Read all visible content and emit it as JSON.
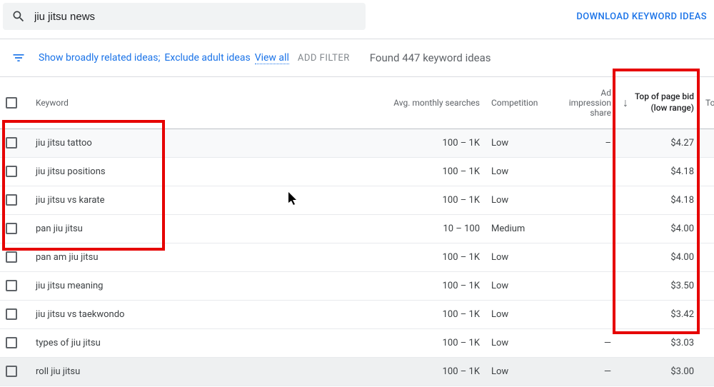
{
  "search": {
    "query": "jiu jitsu news"
  },
  "header": {
    "download": "DOWNLOAD KEYWORD IDEAS"
  },
  "filters": {
    "broadly": "Show broadly related ideas;",
    "exclude": "Exclude adult ideas",
    "view_all": "View all",
    "add_filter": "ADD FILTER",
    "found": "Found 447 keyword ideas"
  },
  "columns": {
    "keyword": "Keyword",
    "searches": "Avg. monthly searches",
    "competition": "Competition",
    "share": "Ad impression share",
    "bid_low": "Top of page bid (low range)",
    "last": "To"
  },
  "rows": [
    {
      "keyword": "jiu jitsu tattoo",
      "searches": "100 – 1K",
      "competition": "Low",
      "share": "–",
      "bid": "$4.27",
      "shaded": true
    },
    {
      "keyword": "jiu jitsu positions",
      "searches": "100 – 1K",
      "competition": "Low",
      "share": "",
      "bid": "$4.18",
      "shaded": false
    },
    {
      "keyword": "jiu jitsu vs karate",
      "searches": "100 – 1K",
      "competition": "Low",
      "share": "",
      "bid": "$4.18",
      "shaded": false
    },
    {
      "keyword": "pan jiu jitsu",
      "searches": "10 – 100",
      "competition": "Medium",
      "share": "",
      "bid": "$4.00",
      "shaded": false
    },
    {
      "keyword": "pan am jiu jitsu",
      "searches": "100 – 1K",
      "competition": "Low",
      "share": "",
      "bid": "$4.00",
      "shaded": false
    },
    {
      "keyword": "jiu jitsu meaning",
      "searches": "100 – 1K",
      "competition": "Low",
      "share": "",
      "bid": "$3.50",
      "shaded": false
    },
    {
      "keyword": "jiu jitsu vs taekwondo",
      "searches": "100 – 1K",
      "competition": "Low",
      "share": "",
      "bid": "$3.42",
      "shaded": false
    },
    {
      "keyword": "types of jiu jitsu",
      "searches": "100 – 1K",
      "competition": "Low",
      "share": "—",
      "bid": "$3.03",
      "shaded": false
    },
    {
      "keyword": "roll jiu jitsu",
      "searches": "100 – 1K",
      "competition": "Low",
      "share": "—",
      "bid": "$3.00",
      "shaded": true
    }
  ]
}
